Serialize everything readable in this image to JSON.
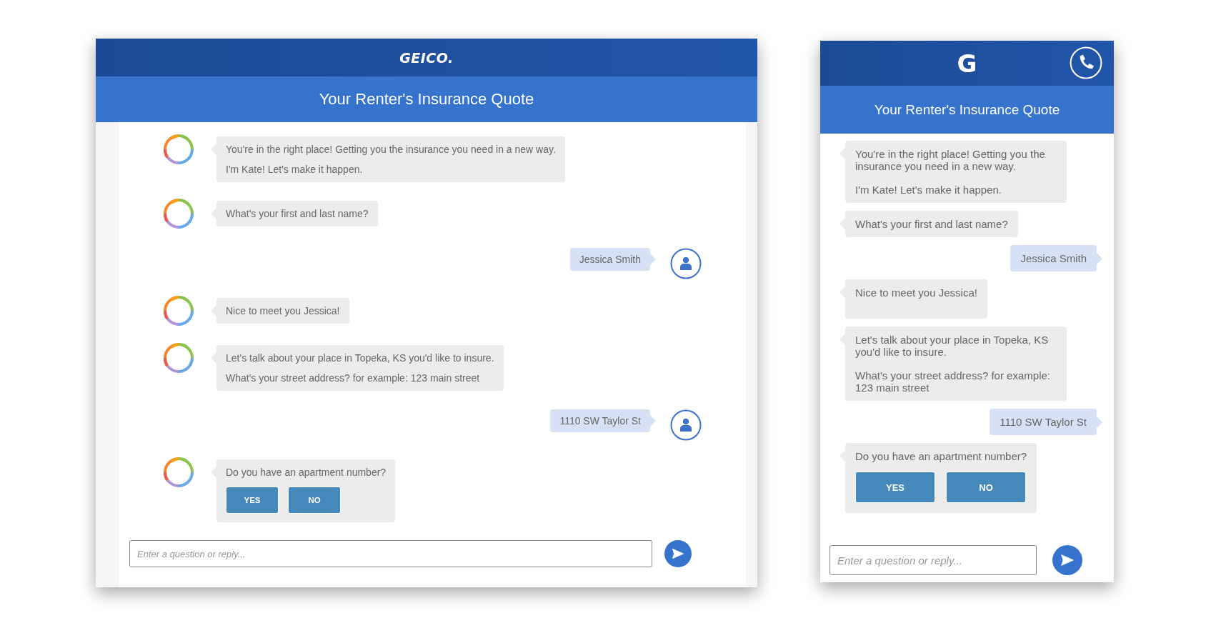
{
  "desktop": {
    "logo": "GEICO.",
    "title": "Your Renter's Insurance Quote",
    "messages": [
      {
        "kind": "bot",
        "paragraphs": [
          "You're in the right place! Getting you the insurance you need in a new way.",
          "I'm Kate! Let's make it happen."
        ]
      },
      {
        "kind": "bot",
        "paragraphs": [
          "What's your first and last name?"
        ]
      },
      {
        "kind": "user",
        "paragraphs": [
          "Jessica Smith"
        ]
      },
      {
        "kind": "bot",
        "paragraphs": [
          "Nice to meet you Jessica!"
        ]
      },
      {
        "kind": "bot",
        "paragraphs": [
          "Let's talk about your place in Topeka, KS you'd like to insure.",
          "What's your street address? for example: 123 main street"
        ]
      },
      {
        "kind": "user",
        "paragraphs": [
          "1110 SW Taylor St"
        ]
      },
      {
        "kind": "bot",
        "paragraphs": [
          "Do you have an apartment number?"
        ],
        "buttons": [
          "YES",
          "NO"
        ]
      }
    ],
    "input": {
      "placeholder": "Enter a question or reply..."
    }
  },
  "mobile": {
    "logo": "G",
    "title": "Your Renter's Insurance Quote",
    "messages": [
      {
        "kind": "bot",
        "paragraphs": [
          "You're in the right place! Getting you the insurance you need in a new way.",
          "I'm Kate! Let's make it happen."
        ]
      },
      {
        "kind": "bot",
        "paragraphs": [
          "What's your first and last name?"
        ]
      },
      {
        "kind": "user",
        "paragraphs": [
          "Jessica Smith"
        ]
      },
      {
        "kind": "bot",
        "paragraphs": [
          "Nice to meet you Jessica!"
        ]
      },
      {
        "kind": "bot",
        "paragraphs": [
          "Let's talk about your place in Topeka, KS you'd like to insure.",
          "What's your street address? for example: 123 main street"
        ]
      },
      {
        "kind": "user",
        "paragraphs": [
          "1110 SW Taylor St"
        ]
      },
      {
        "kind": "bot",
        "paragraphs": [
          "Do you have an apartment number?"
        ],
        "buttons": [
          "YES",
          "NO"
        ]
      }
    ],
    "input": {
      "placeholder": "Enter a question or reply..."
    }
  }
}
